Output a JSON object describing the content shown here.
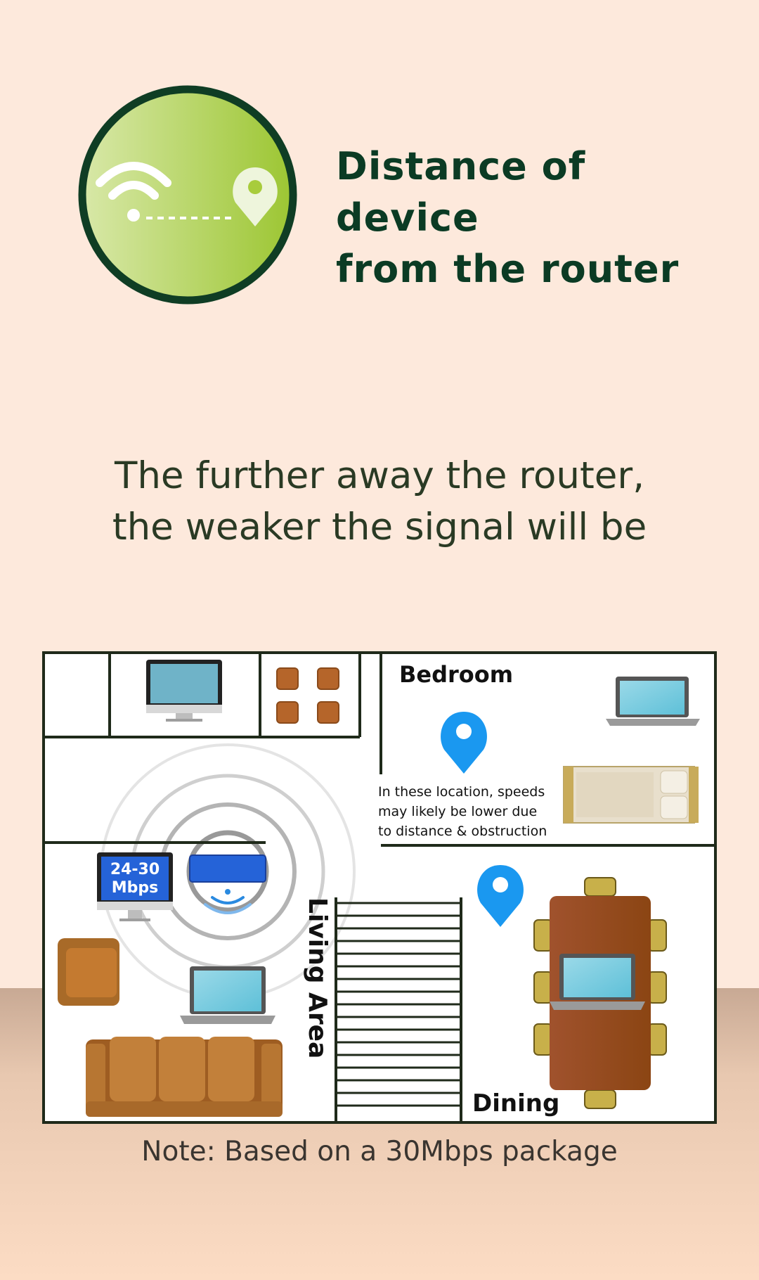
{
  "header": {
    "title_line1": "Distance of device",
    "title_line2": "from the router",
    "icon": "wifi-distance-icon"
  },
  "subtitle": {
    "line1": "The further away the router,",
    "line2": "the weaker the signal will be"
  },
  "floorplan": {
    "room_bedroom": "Bedroom",
    "room_living": "Living Area",
    "room_dining": "Dining",
    "speed_line1": "24-30",
    "speed_line2": "Mbps",
    "callout_line1": "In these location, speeds",
    "callout_line2": "may likely be lower due",
    "callout_line3": "to distance & obstruction"
  },
  "note": "Note: Based on a 30Mbps package",
  "colors": {
    "background": "#fde9dc",
    "title": "#0b3b24",
    "ring": "#0f3d24",
    "badge_green": "#a8cc3c",
    "pin_blue": "#1a98f0",
    "router_blue": "#2563d8",
    "wall": "#1f2a1a"
  }
}
